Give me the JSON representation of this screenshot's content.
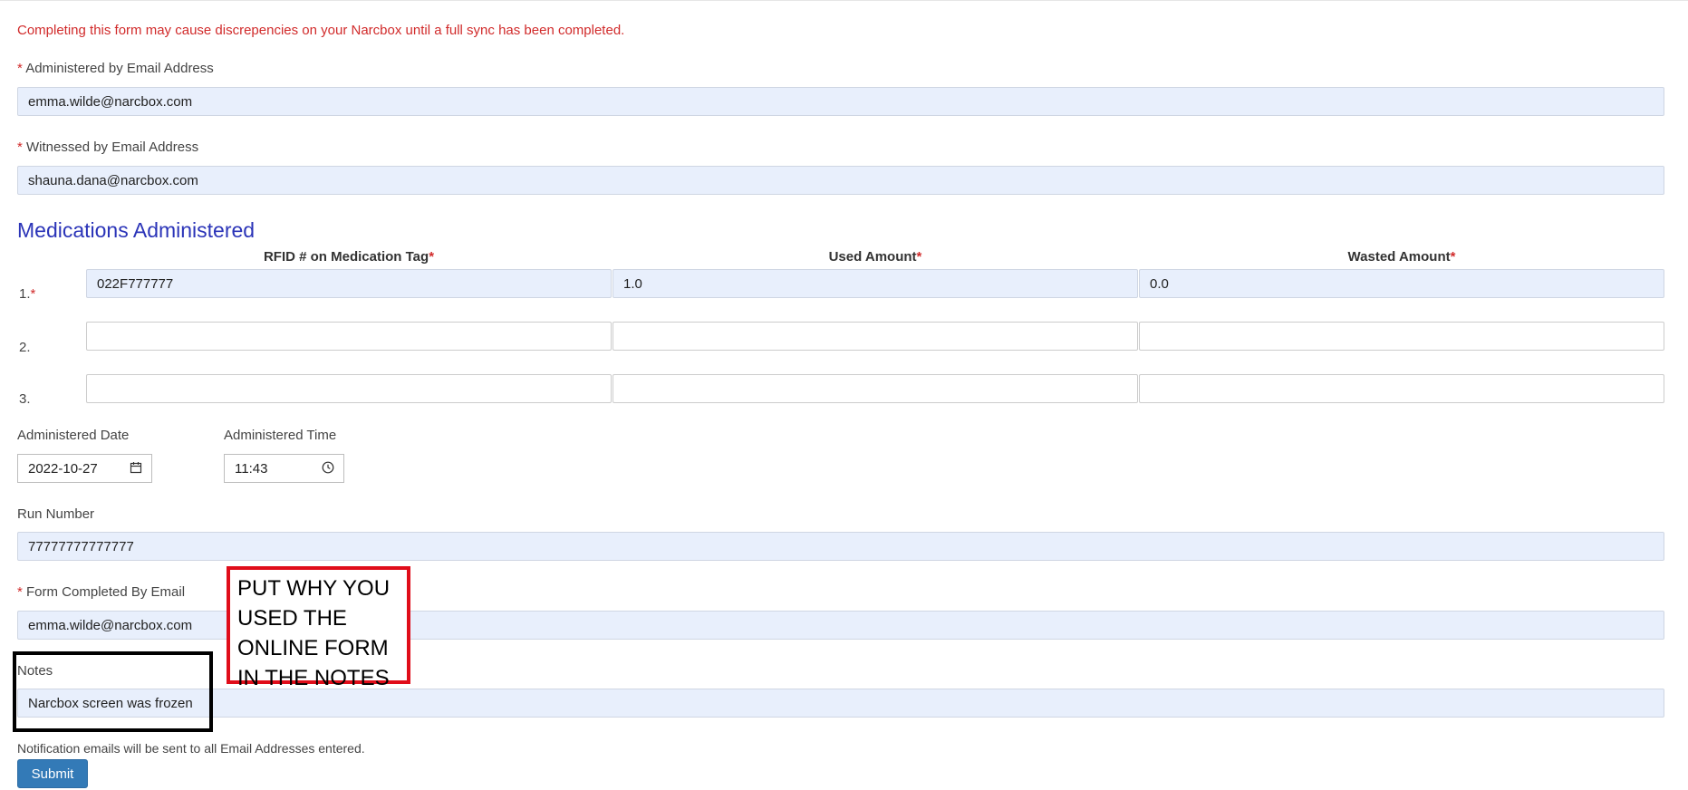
{
  "form": {
    "warning": "Completing this form may cause discrepencies on your Narcbox until a full sync has been completed.",
    "required_mark": "*",
    "administered_by": {
      "label": "Administered by Email Address",
      "value": "emma.wilde@narcbox.com"
    },
    "witnessed_by": {
      "label": "Witnessed by Email Address",
      "value": "shauna.dana@narcbox.com"
    },
    "medications": {
      "title": "Medications Administered",
      "headers": {
        "rfid": "RFID # on Medication Tag",
        "used": "Used Amount",
        "wasted": "Wasted Amount"
      },
      "rows": [
        {
          "num": "1.",
          "rfid": "022F777777",
          "used": "1.0",
          "wasted": "0.0"
        },
        {
          "num": "2.",
          "rfid": "",
          "used": "",
          "wasted": ""
        },
        {
          "num": "3.",
          "rfid": "",
          "used": "",
          "wasted": ""
        }
      ]
    },
    "administered_date": {
      "label": "Administered Date",
      "value": "2022-10-27",
      "icon": "calendar-icon"
    },
    "administered_time": {
      "label": "Administered Time",
      "value": "11:43",
      "icon": "clock-icon"
    },
    "run_number": {
      "label": "Run Number",
      "value": "77777777777777"
    },
    "completed_by": {
      "label": "Form Completed By Email",
      "value": "emma.wilde@narcbox.com"
    },
    "notes": {
      "label": "Notes",
      "value": "Narcbox screen was frozen"
    },
    "notification_text": "Notification emails will be sent to all Email Addresses entered.",
    "submit_label": "Submit"
  },
  "annotations": {
    "callout_text": "PUT WHY YOU\nUSED THE\nONLINE FORM\nIN THE NOTES",
    "callout_color": "#e00d1a",
    "highlight_color": "#000000"
  },
  "colors": {
    "warning": "#d12b2b",
    "section_title": "#2b34b8",
    "input_fill": "#e8effc",
    "submit": "#337ab7"
  }
}
